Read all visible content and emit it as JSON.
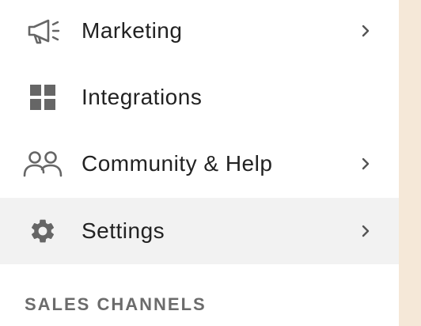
{
  "nav": {
    "items": [
      {
        "label": "Marketing",
        "icon": "megaphone-icon",
        "has_chevron": true,
        "active": false
      },
      {
        "label": "Integrations",
        "icon": "grid-icon",
        "has_chevron": false,
        "active": false
      },
      {
        "label": "Community & Help",
        "icon": "people-icon",
        "has_chevron": true,
        "active": false
      },
      {
        "label": "Settings",
        "icon": "gear-icon",
        "has_chevron": true,
        "active": true
      }
    ]
  },
  "section": {
    "title": "SALES CHANNELS"
  },
  "colors": {
    "panel_bg": "#ffffff",
    "active_bg": "#f2f2f2",
    "backdrop": "#f5e8d8",
    "text": "#222222",
    "icon": "#666666",
    "section_title": "#6b6b6b"
  }
}
